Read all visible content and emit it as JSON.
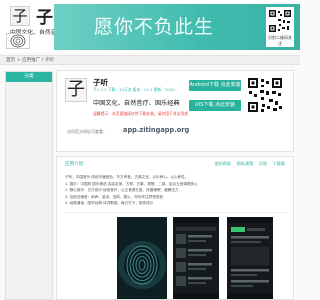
{
  "header": {
    "logo_char": "子",
    "brand": "子听",
    "slogan": "中国文化、自然音疗、国学",
    "banner_text": "愿你不负此生",
    "banner_qr_caption": "识别二维码关注"
  },
  "breadcrumb": "首页 > 应用推广 / 子听",
  "sidebar": {
    "header": "分类"
  },
  "app": {
    "icon_char": "子",
    "name": "子听",
    "meta": "子1.2.3 下载：10万次 版本：v1.2 更新：2020",
    "tagline": "中国文化、自然音疗、国乐经典",
    "warning": "温馨提示：本页面链接仅供下载安装，请勿用于非法用途",
    "url_label": "访问官方网址可查看：",
    "url_value": "app.zitingapp.org",
    "android_button": "Android下载 点此安装",
    "ios_button": "iOS下载 点此安装"
  },
  "detail": {
    "title": "应用介绍",
    "links": [
      "使用帮助",
      "隐私政策",
      "问答",
      "下载量"
    ],
    "intro": [
      "子听，中国音乐·传统乐器音色，东方声音，古典文化，以乐养心，以心养性。",
      "1. 国乐：中国风·国乐精选·名曲名家，古琴、古筝、琵琶、二胡，结合五音调理身心",
      "2. 静心音疗：五行音乐·经络音疗，以五音调五脏，改善睡眠，缓解压力",
      "3. 自然白噪音：雨声、溪流、虫鸣、篝火，伴你专注冥想放松",
      "4. 经典诵读：国学经典·诗词歌赋，每日打卡，陪伴成长"
    ]
  },
  "colors": {
    "accent": "#2eb5a2",
    "banner": "#3fbcae",
    "warning": "#e0453a"
  }
}
